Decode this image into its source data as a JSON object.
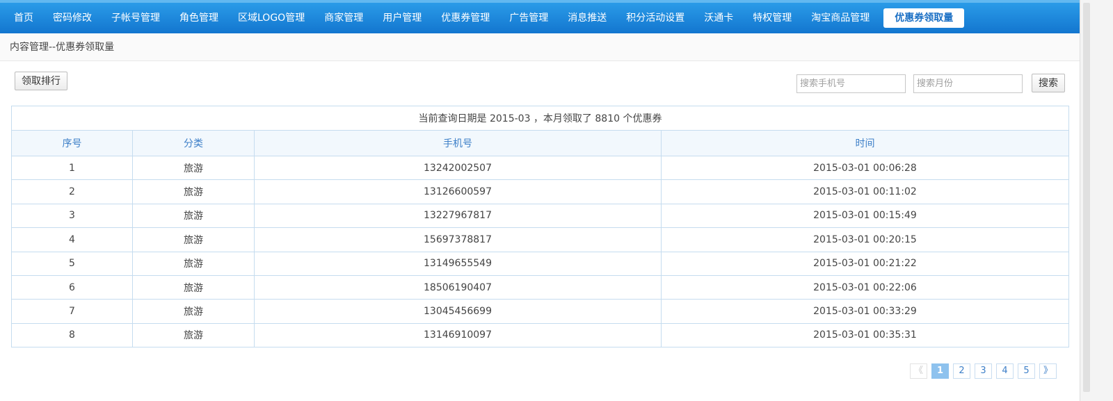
{
  "nav": {
    "items": [
      {
        "label": "首页"
      },
      {
        "label": "密码修改"
      },
      {
        "label": "子帐号管理"
      },
      {
        "label": "角色管理"
      },
      {
        "label": "区域LOGO管理"
      },
      {
        "label": "商家管理"
      },
      {
        "label": "用户管理"
      },
      {
        "label": "优惠券管理"
      },
      {
        "label": "广告管理"
      },
      {
        "label": "消息推送"
      },
      {
        "label": "积分活动设置"
      },
      {
        "label": "沃通卡"
      },
      {
        "label": "特权管理"
      },
      {
        "label": "淘宝商品管理"
      }
    ],
    "active": {
      "label": "优惠券领取量"
    }
  },
  "breadcrumb": "内容管理--优惠券领取量",
  "toolbar": {
    "rank_button": "领取排行",
    "phone_placeholder": "搜索手机号",
    "month_placeholder": "搜索月份",
    "search_button": "搜索"
  },
  "table": {
    "caption": "当前查询日期是 2015-03 ，本月领取了 8810 个优惠券",
    "headers": {
      "index": "序号",
      "category": "分类",
      "phone": "手机号",
      "time": "时间"
    },
    "rows": [
      {
        "index": "1",
        "category": "旅游",
        "phone": "13242002507",
        "time": "2015-03-01 00:06:28"
      },
      {
        "index": "2",
        "category": "旅游",
        "phone": "13126600597",
        "time": "2015-03-01 00:11:02"
      },
      {
        "index": "3",
        "category": "旅游",
        "phone": "13227967817",
        "time": "2015-03-01 00:15:49"
      },
      {
        "index": "4",
        "category": "旅游",
        "phone": "15697378817",
        "time": "2015-03-01 00:20:15"
      },
      {
        "index": "5",
        "category": "旅游",
        "phone": "13149655549",
        "time": "2015-03-01 00:21:22"
      },
      {
        "index": "6",
        "category": "旅游",
        "phone": "18506190407",
        "time": "2015-03-01 00:22:06"
      },
      {
        "index": "7",
        "category": "旅游",
        "phone": "13045456699",
        "time": "2015-03-01 00:33:29"
      },
      {
        "index": "8",
        "category": "旅游",
        "phone": "13146910097",
        "time": "2015-03-01 00:35:31"
      }
    ]
  },
  "pagination": {
    "prev": "《",
    "pages": [
      "1",
      "2",
      "3",
      "4",
      "5"
    ],
    "next": "》",
    "current": "1"
  },
  "colors": {
    "nav_bg": "#1a86dc",
    "accent": "#3d7fc8",
    "current_page": "#8ec2ee"
  }
}
